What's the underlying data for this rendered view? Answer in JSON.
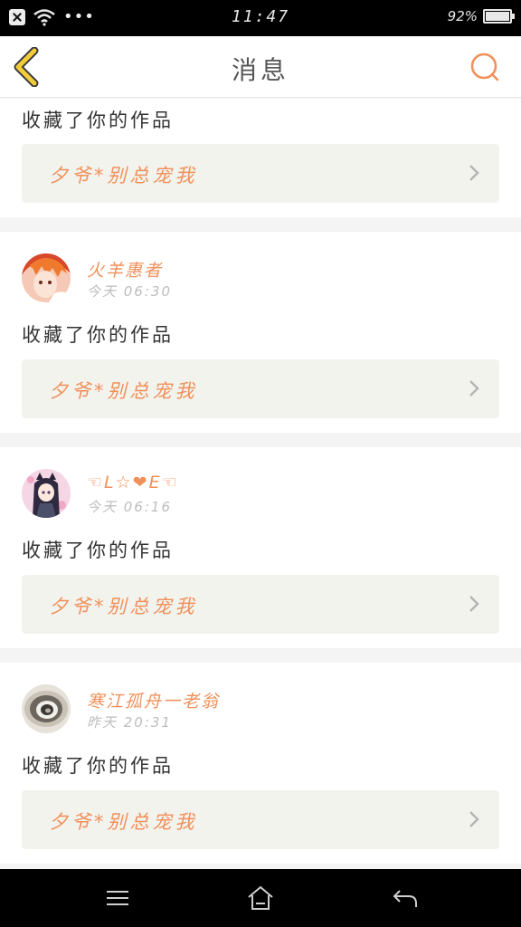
{
  "status_bar": {
    "time": "11:47",
    "battery": "92%",
    "battery_level": 0.92
  },
  "header": {
    "title": "消息",
    "back_icon": "chevron-left-icon",
    "search_icon": "search-icon"
  },
  "messages": [
    {
      "action": "收藏了你的作品",
      "work_title": "夕爷*别总宠我"
    },
    {
      "user": "火羊惠者",
      "time": "今天 06:30",
      "action": "收藏了你的作品",
      "work_title": "夕爷*别总宠我"
    },
    {
      "user": "☜L☆❤E☜",
      "time": "今天 06:16",
      "action": "收藏了你的作品",
      "work_title": "夕爷*别总宠我"
    },
    {
      "user": "寒江孤舟一老翁",
      "time": "昨天 20:31",
      "action": "收藏了你的作品",
      "work_title": "夕爷*别总宠我"
    }
  ],
  "colors": {
    "accent": "#f0905a",
    "back_icon": "#f2cc3a",
    "card_inner": "#f3f3ee"
  },
  "nav": {
    "menu_icon": "menu-icon",
    "home_icon": "home-icon",
    "back_icon": "back-arrow-icon"
  }
}
